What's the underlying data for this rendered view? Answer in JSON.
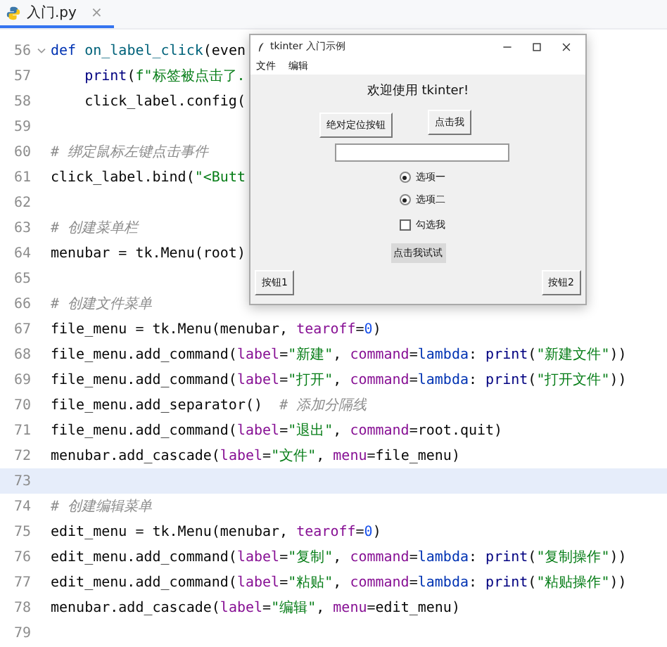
{
  "editor_tab": {
    "label": "入门.py",
    "close": "×"
  },
  "code_lines": [
    {
      "number": "56",
      "foldable": true,
      "current": false,
      "tokens": [
        {
          "kind": "keyword",
          "text": "def "
        },
        {
          "kind": "function",
          "text": "on_label_click"
        },
        {
          "kind": "plain",
          "text": "(even"
        }
      ]
    },
    {
      "number": "57",
      "foldable": false,
      "current": false,
      "tokens": [
        {
          "kind": "builtin",
          "text": "    print"
        },
        {
          "kind": "plain",
          "text": "("
        },
        {
          "kind": "string",
          "text": "f\"标签被点击了."
        }
      ]
    },
    {
      "number": "58",
      "foldable": false,
      "current": false,
      "tokens": [
        {
          "kind": "plain",
          "text": "    click_label.config("
        }
      ]
    },
    {
      "number": "59",
      "foldable": false,
      "current": false
    },
    {
      "number": "60",
      "foldable": false,
      "current": false,
      "tokens": [
        {
          "kind": "comment",
          "text": "# 绑定鼠标左键点击事件"
        }
      ]
    },
    {
      "number": "61",
      "foldable": false,
      "current": false,
      "tokens": [
        {
          "kind": "plain",
          "text": "click_label.bind("
        },
        {
          "kind": "string",
          "text": "\"<Butt"
        }
      ]
    },
    {
      "number": "62",
      "foldable": false,
      "current": false
    },
    {
      "number": "63",
      "foldable": false,
      "current": false,
      "tokens": [
        {
          "kind": "comment",
          "text": "# 创建菜单栏"
        }
      ]
    },
    {
      "number": "64",
      "foldable": false,
      "current": false,
      "tokens": [
        {
          "kind": "plain",
          "text": "menubar = tk.Menu(root)"
        }
      ]
    },
    {
      "number": "65",
      "foldable": false,
      "current": false
    },
    {
      "number": "66",
      "foldable": false,
      "current": false,
      "tokens": [
        {
          "kind": "comment",
          "text": "# 创建文件菜单"
        }
      ]
    },
    {
      "number": "67",
      "foldable": false,
      "current": false,
      "tokens": [
        {
          "kind": "plain",
          "text": "file_menu = tk.Menu(menubar, "
        },
        {
          "kind": "param",
          "text": "tearoff"
        },
        {
          "kind": "plain",
          "text": "="
        },
        {
          "kind": "number",
          "text": "0"
        },
        {
          "kind": "plain",
          "text": ")"
        }
      ]
    },
    {
      "number": "68",
      "foldable": false,
      "current": false,
      "tokens": [
        {
          "kind": "plain",
          "text": "file_menu.add_command("
        },
        {
          "kind": "param",
          "text": "label"
        },
        {
          "kind": "plain",
          "text": "="
        },
        {
          "kind": "string",
          "text": "\"新建\""
        },
        {
          "kind": "plain",
          "text": ", "
        },
        {
          "kind": "param",
          "text": "command"
        },
        {
          "kind": "plain",
          "text": "="
        },
        {
          "kind": "keyword",
          "text": "lambda"
        },
        {
          "kind": "plain",
          "text": ": "
        },
        {
          "kind": "builtin",
          "text": "print"
        },
        {
          "kind": "plain",
          "text": "("
        },
        {
          "kind": "string",
          "text": "\"新建文件\""
        },
        {
          "kind": "plain",
          "text": "))"
        }
      ]
    },
    {
      "number": "69",
      "foldable": false,
      "current": false,
      "tokens": [
        {
          "kind": "plain",
          "text": "file_menu.add_command("
        },
        {
          "kind": "param",
          "text": "label"
        },
        {
          "kind": "plain",
          "text": "="
        },
        {
          "kind": "string",
          "text": "\"打开\""
        },
        {
          "kind": "plain",
          "text": ", "
        },
        {
          "kind": "param",
          "text": "command"
        },
        {
          "kind": "plain",
          "text": "="
        },
        {
          "kind": "keyword",
          "text": "lambda"
        },
        {
          "kind": "plain",
          "text": ": "
        },
        {
          "kind": "builtin",
          "text": "print"
        },
        {
          "kind": "plain",
          "text": "("
        },
        {
          "kind": "string",
          "text": "\"打开文件\""
        },
        {
          "kind": "plain",
          "text": "))"
        }
      ]
    },
    {
      "number": "70",
      "foldable": false,
      "current": false,
      "tokens": [
        {
          "kind": "plain",
          "text": "file_menu.add_separator()  "
        },
        {
          "kind": "comment",
          "text": "# 添加分隔线"
        }
      ]
    },
    {
      "number": "71",
      "foldable": false,
      "current": false,
      "tokens": [
        {
          "kind": "plain",
          "text": "file_menu.add_command("
        },
        {
          "kind": "param",
          "text": "label"
        },
        {
          "kind": "plain",
          "text": "="
        },
        {
          "kind": "string",
          "text": "\"退出\""
        },
        {
          "kind": "plain",
          "text": ", "
        },
        {
          "kind": "param",
          "text": "command"
        },
        {
          "kind": "plain",
          "text": "=root.quit)"
        }
      ]
    },
    {
      "number": "72",
      "foldable": false,
      "current": false,
      "tokens": [
        {
          "kind": "plain",
          "text": "menubar.add_cascade("
        },
        {
          "kind": "param",
          "text": "label"
        },
        {
          "kind": "plain",
          "text": "="
        },
        {
          "kind": "string",
          "text": "\"文件\""
        },
        {
          "kind": "plain",
          "text": ", "
        },
        {
          "kind": "param",
          "text": "menu"
        },
        {
          "kind": "plain",
          "text": "=file_menu)"
        }
      ]
    },
    {
      "number": "73",
      "foldable": false,
      "current": true
    },
    {
      "number": "74",
      "foldable": false,
      "current": false,
      "tokens": [
        {
          "kind": "comment",
          "text": "# 创建编辑菜单"
        }
      ]
    },
    {
      "number": "75",
      "foldable": false,
      "current": false,
      "tokens": [
        {
          "kind": "plain",
          "text": "edit_menu = tk.Menu(menubar, "
        },
        {
          "kind": "param",
          "text": "tearoff"
        },
        {
          "kind": "plain",
          "text": "="
        },
        {
          "kind": "number",
          "text": "0"
        },
        {
          "kind": "plain",
          "text": ")"
        }
      ]
    },
    {
      "number": "76",
      "foldable": false,
      "current": false,
      "tokens": [
        {
          "kind": "plain",
          "text": "edit_menu.add_command("
        },
        {
          "kind": "param",
          "text": "label"
        },
        {
          "kind": "plain",
          "text": "="
        },
        {
          "kind": "string",
          "text": "\"复制\""
        },
        {
          "kind": "plain",
          "text": ", "
        },
        {
          "kind": "param",
          "text": "command"
        },
        {
          "kind": "plain",
          "text": "="
        },
        {
          "kind": "keyword",
          "text": "lambda"
        },
        {
          "kind": "plain",
          "text": ": "
        },
        {
          "kind": "builtin",
          "text": "print"
        },
        {
          "kind": "plain",
          "text": "("
        },
        {
          "kind": "string",
          "text": "\"复制操作\""
        },
        {
          "kind": "plain",
          "text": "))"
        }
      ]
    },
    {
      "number": "77",
      "foldable": false,
      "current": false,
      "tokens": [
        {
          "kind": "plain",
          "text": "edit_menu.add_command("
        },
        {
          "kind": "param",
          "text": "label"
        },
        {
          "kind": "plain",
          "text": "="
        },
        {
          "kind": "string",
          "text": "\"粘贴\""
        },
        {
          "kind": "plain",
          "text": ", "
        },
        {
          "kind": "param",
          "text": "command"
        },
        {
          "kind": "plain",
          "text": "="
        },
        {
          "kind": "keyword",
          "text": "lambda"
        },
        {
          "kind": "plain",
          "text": ": "
        },
        {
          "kind": "builtin",
          "text": "print"
        },
        {
          "kind": "plain",
          "text": "("
        },
        {
          "kind": "string",
          "text": "\"粘贴操作\""
        },
        {
          "kind": "plain",
          "text": "))"
        }
      ]
    },
    {
      "number": "78",
      "foldable": false,
      "current": false,
      "tokens": [
        {
          "kind": "plain",
          "text": "menubar.add_cascade("
        },
        {
          "kind": "param",
          "text": "label"
        },
        {
          "kind": "plain",
          "text": "="
        },
        {
          "kind": "string",
          "text": "\"编辑\""
        },
        {
          "kind": "plain",
          "text": ", "
        },
        {
          "kind": "param",
          "text": "menu"
        },
        {
          "kind": "plain",
          "text": "=edit_menu)"
        }
      ]
    },
    {
      "number": "79",
      "foldable": false,
      "current": false
    }
  ],
  "app_window": {
    "title": "tkinter 入门示例",
    "menu": [
      "文件",
      "编辑"
    ],
    "welcome": "欢迎使用 tkinter!",
    "buttons": [
      "绝对定位按钮",
      "点击我"
    ],
    "radios": [
      {
        "label": "选项一",
        "selected": true
      },
      {
        "label": "选项二",
        "selected": true
      }
    ],
    "checkbox": {
      "label": "勾选我",
      "checked": false
    },
    "flat_button": "点击我试试",
    "bottom_buttons": [
      "按钮1",
      "按钮2"
    ]
  }
}
